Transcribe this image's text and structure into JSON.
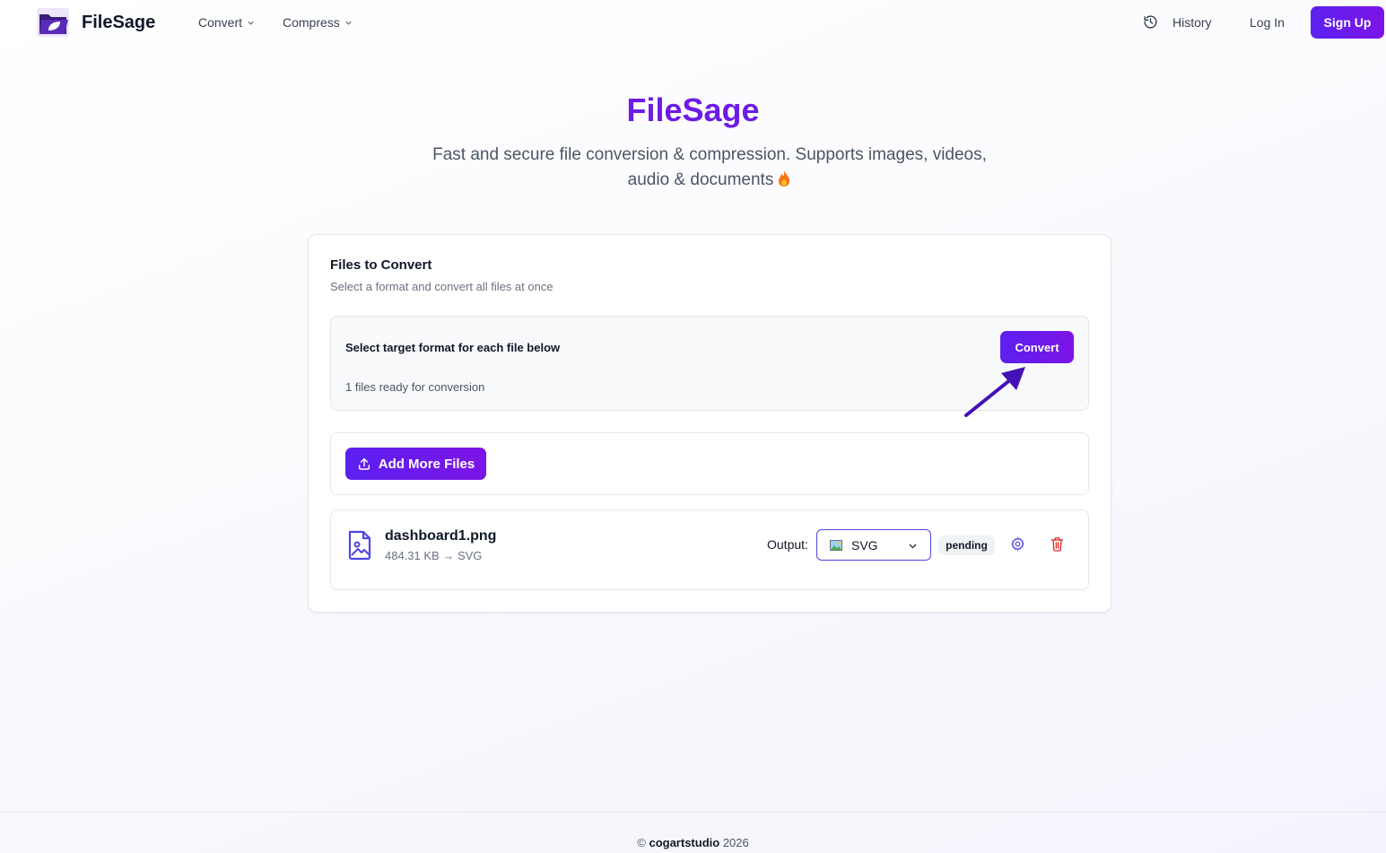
{
  "header": {
    "brand": "FileSage",
    "nav": [
      {
        "label": "Convert"
      },
      {
        "label": "Compress"
      }
    ],
    "history_label": "History",
    "login_label": "Log In",
    "signup_label": "Sign Up"
  },
  "hero": {
    "title": "FileSage",
    "subtitle": "Fast and secure file conversion & compression. Supports images, videos, audio & documents"
  },
  "card": {
    "title": "Files to Convert",
    "description": "Select a format and convert all files at once",
    "format_label": "Select target format for each file below",
    "ready_count": "1 files ready for conversion",
    "convert_label": "Convert",
    "add_files_label": "Add More Files",
    "files": [
      {
        "name": "dashboard1.png",
        "meta": "484.31 KB → SVG",
        "output_label": "Output:",
        "output_format": "SVG",
        "status": "pending"
      }
    ]
  },
  "footer": {
    "copyright_symbol": "©",
    "owner": "cogartstudio",
    "year": "2026"
  },
  "colors": {
    "accent": "#6d1be6",
    "button_gradient_start": "#5b21f0",
    "button_gradient_end": "#7c14e6",
    "annotation_arrow": "#4311b5",
    "delete": "#dc2626"
  }
}
